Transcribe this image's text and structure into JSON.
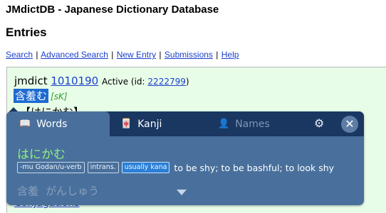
{
  "site": {
    "title": "JMdictDB - Japanese Dictionary Database"
  },
  "page": {
    "title": "Entries"
  },
  "nav": {
    "links": [
      {
        "label": "Search"
      },
      {
        "label": "Advanced Search"
      },
      {
        "label": "New Entry"
      },
      {
        "label": "Submissions"
      },
      {
        "label": "Help"
      }
    ],
    "separator": "|"
  },
  "entry": {
    "corpus": "jmdict",
    "seq": "1010190",
    "status_prefix": "Active (id: ",
    "id": "2222799",
    "status_suffix": ")",
    "kanji": "含羞む",
    "kanji_tag": "[sK]",
    "reading": "【はにかむ】",
    "conjugations_link": "Conjugations"
  },
  "popup": {
    "tabs": [
      {
        "label": "Words",
        "icon": "book-icon",
        "glyph": "📖",
        "active": true
      },
      {
        "label": "Kanji",
        "icon": "kanji-card-icon",
        "glyph": "🀄",
        "active": false
      },
      {
        "label": "Names",
        "icon": "person-icon",
        "glyph": "👤",
        "active": false
      }
    ],
    "settings_glyph": "⚙",
    "close_glyph": "✕",
    "word": {
      "reading": "はにかむ",
      "tags": [
        "-mu Godan/u-verb",
        "intrans.",
        "usually kana"
      ],
      "gloss": "to be shy; to be bashful; to look shy"
    },
    "next_entry": {
      "kanji": "含羞",
      "reading": "がんしゅう"
    }
  },
  "colors": {
    "entry_bg": "#e8fde8",
    "popup_bg": "#49709c",
    "popup_tabbar": "#1a3761",
    "reading_green": "#8ff07e",
    "link_blue": "#1a3fcc",
    "highlight_blue": "#1e6ad2"
  }
}
